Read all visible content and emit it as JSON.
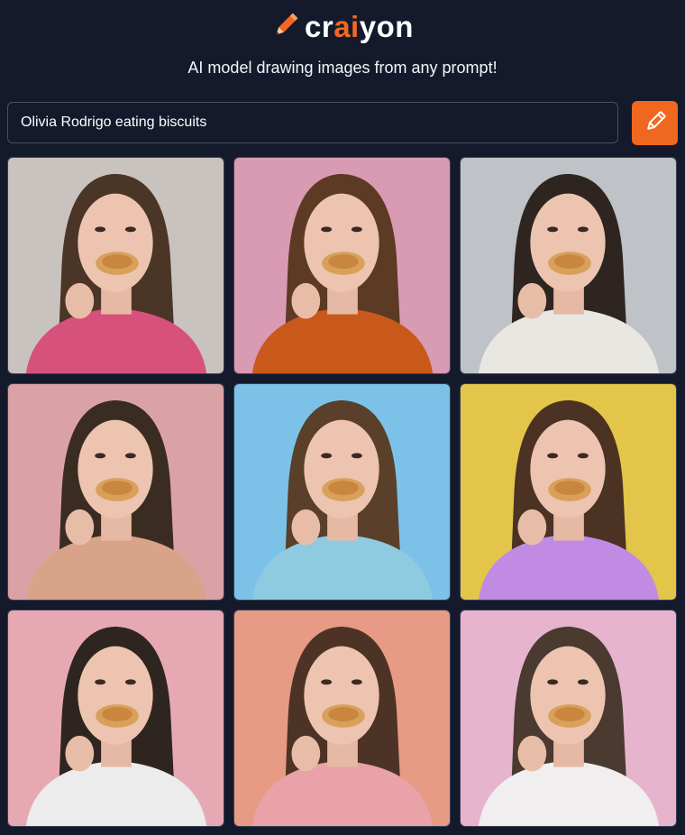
{
  "app": {
    "logo_prefix": "cr",
    "logo_accent": "ai",
    "logo_suffix": "yon",
    "logo_icon": "pencil-icon",
    "tagline": "AI model drawing images from any prompt!"
  },
  "search": {
    "value": "Olivia Rodrigo eating biscuits",
    "button_icon": "pencil-icon"
  },
  "colors": {
    "background": "#141a2c",
    "accent": "#f26722"
  },
  "gallery": {
    "images": [
      {
        "bg": "#c9c3bf",
        "shirt": "#d6527d",
        "hair": "#4a3527"
      },
      {
        "bg": "#d99ab3",
        "shirt": "#c9591b",
        "hair": "#5c3a24"
      },
      {
        "bg": "#bfc2c6",
        "shirt": "#e9e7e2",
        "hair": "#2e2520"
      },
      {
        "bg": "#dba2a6",
        "shirt": "#d9a38a",
        "hair": "#3b2c22"
      },
      {
        "bg": "#7cc2e8",
        "shirt": "#8fcbe0",
        "hair": "#5a3f2a"
      },
      {
        "bg": "#e3c54a",
        "shirt": "#c28be3",
        "hair": "#4b3223"
      },
      {
        "bg": "#e6a9b4",
        "shirt": "#ececec",
        "hair": "#2f2520"
      },
      {
        "bg": "#e79a84",
        "shirt": "#e8a2a8",
        "hair": "#4d3325"
      },
      {
        "bg": "#e6b4cc",
        "shirt": "#f1eef0",
        "hair": "#4a3a30"
      }
    ]
  }
}
